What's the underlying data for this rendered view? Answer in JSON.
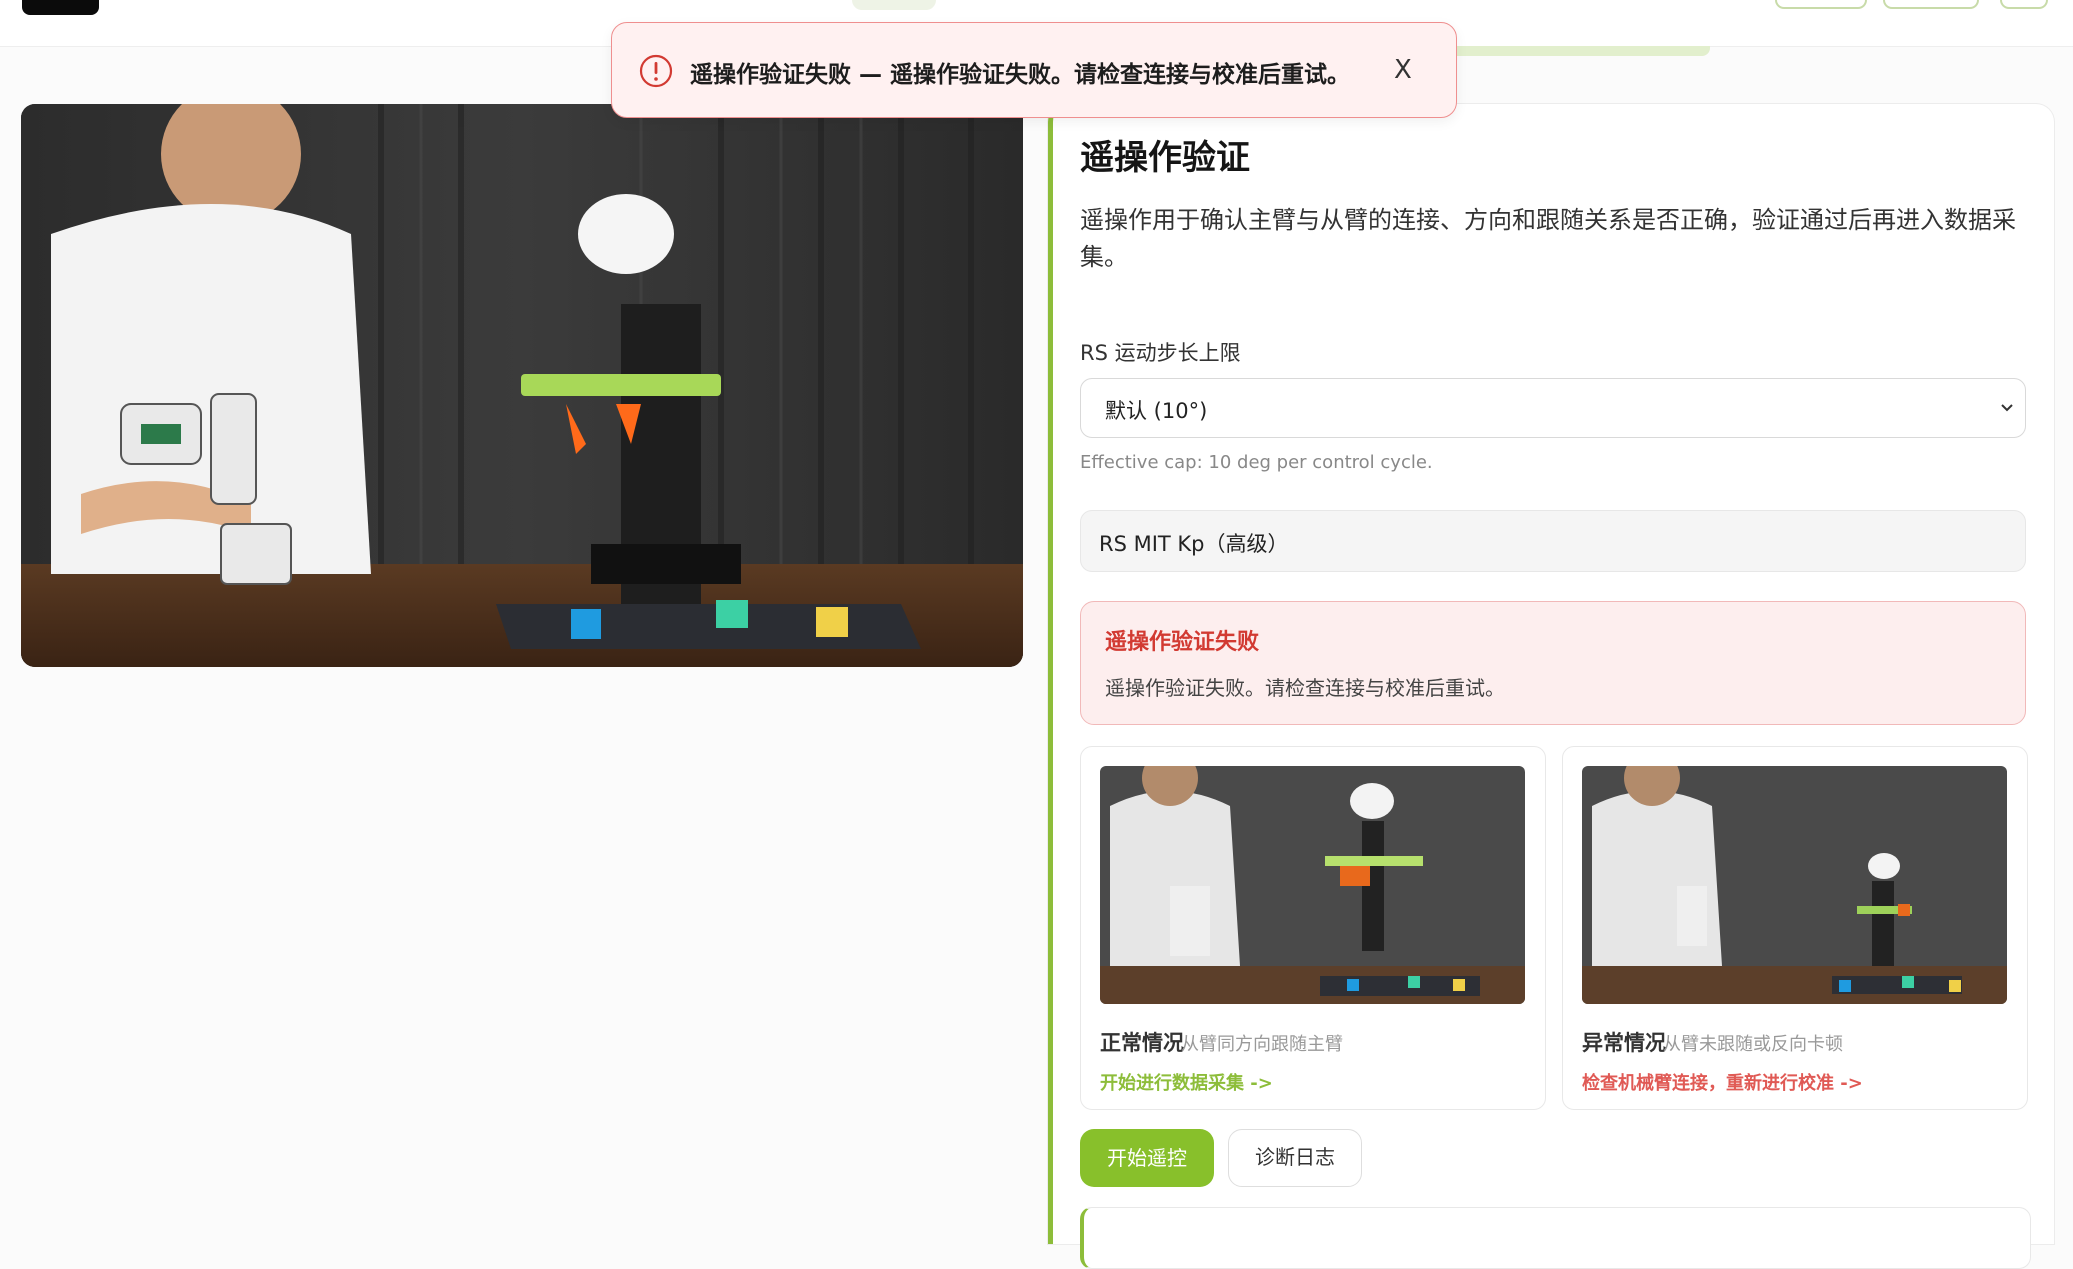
{
  "toast": {
    "message": "遥操作验证失败 — 遥操作验证失败。请检查连接与校准后重试。",
    "close_label": "X",
    "icon": "alert-circle-icon"
  },
  "panel": {
    "title": "遥操作验证",
    "description": "遥操作用于确认主臂与从臂的连接、方向和跟随关系是否正确，验证通过后再进入数据采集。",
    "step_limit_label": "RS 运动步长上限",
    "step_limit_value": "默认 (10°)",
    "step_limit_hint": "Effective cap: 10 deg per control cycle.",
    "kp_label": "RS MIT Kp（高级）",
    "error_title": "遥操作验证失败",
    "error_text": "遥操作验证失败。请检查连接与校准后重试。",
    "cases": {
      "normal": {
        "title": "正常情况",
        "subtitle": "从臂同方向跟随主臂",
        "link": "开始进行数据采集 ->"
      },
      "abnormal": {
        "title": "异常情况",
        "subtitle": "从臂未跟随或反向卡顿",
        "link": "检查机械臂连接，重新进行校准 ->"
      }
    },
    "start_button": "开始遥控",
    "log_button": "诊断日志"
  },
  "colors": {
    "accent": "#88c02b",
    "error": "#d23a32",
    "error_bg": "#fdeeee"
  }
}
